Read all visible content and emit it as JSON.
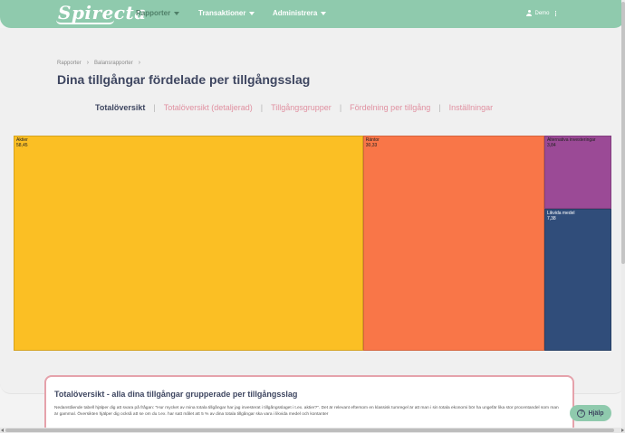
{
  "navbar": {
    "logo": "Spirecta",
    "items": [
      {
        "label": "Rapporter",
        "active": true
      },
      {
        "label": "Transaktioner",
        "active": false
      },
      {
        "label": "Administrera",
        "active": false
      }
    ],
    "user": "Demo"
  },
  "breadcrumb": [
    "Rapporter",
    "Balansrapporter"
  ],
  "page_title": "Dina tillgångar fördelade per tillgångsslag",
  "tabs": [
    {
      "label": "Totalöversikt",
      "active": true
    },
    {
      "label": "Totalöversikt (detaljerad)",
      "active": false
    },
    {
      "label": "Tillgångsgrupper",
      "active": false
    },
    {
      "label": "Fördelning per tillgång",
      "active": false
    },
    {
      "label": "Inställningar",
      "active": false
    }
  ],
  "chart_data": {
    "type": "treemap",
    "title": "",
    "series": [
      {
        "name": "Aktier",
        "value": 58.45,
        "value_label": "58,45",
        "color": "#fbbf24"
      },
      {
        "name": "Räntor",
        "value": 30.33,
        "value_label": "30,33",
        "color": "#f97648"
      },
      {
        "name": "Alternativa investeringar",
        "value": 3.84,
        "value_label": "3,84",
        "color": "#9b4a96"
      },
      {
        "name": "Likvida medel",
        "value": 7.38,
        "value_label": "7,38",
        "color": "#304d7a"
      }
    ]
  },
  "info": {
    "title": "Totalöversikt - alla dina tillgångar grupperade per tillgångsslag",
    "text": "Nedanstående tabell hjälper dig att svara på frågan: \"Hur mycket av mina totala tillgångar har jag investerat i tillgångsslaget i t.ex. aktier?\". Det är relevant eftersom en klassisk tumregel är att man i sin totala ekonomi bör ha ungefär lika stor procentandel som man är gammal. Översikten hjälper dig också att se om du t.ex. har satt målet att 5 % av dina totala tillgångar ska vara i likvida medel och kontanter"
  },
  "help_label": "Hjälp",
  "colors": {
    "brand": "#8fcaad",
    "title": "#3e4660",
    "tab": "#e091a1",
    "card_border": "#e5a2ab"
  }
}
